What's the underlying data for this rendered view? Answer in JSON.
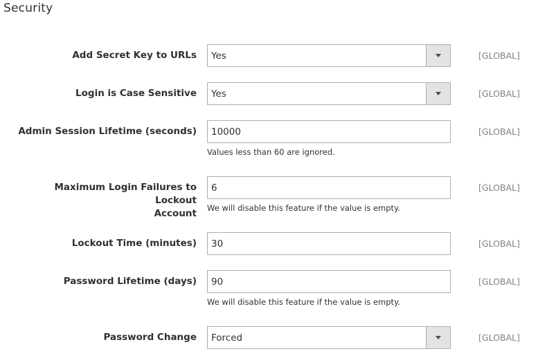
{
  "section": {
    "title": "Security"
  },
  "fields": [
    {
      "label": "Add Secret Key to URLs",
      "type": "select",
      "value": "Yes",
      "scope": "[GLOBAL]"
    },
    {
      "label": "Login is Case Sensitive",
      "type": "select",
      "value": "Yes",
      "scope": "[GLOBAL]"
    },
    {
      "label": "Admin Session Lifetime (seconds)",
      "type": "text",
      "value": "10000",
      "scope": "[GLOBAL]",
      "note": "Values less than 60 are ignored."
    },
    {
      "label_line1": "Maximum Login Failures to Lockout",
      "label_line2": "Account",
      "type": "text",
      "value": "6",
      "scope": "[GLOBAL]",
      "note": "We will disable this feature if the value is empty."
    },
    {
      "label": "Lockout Time (minutes)",
      "type": "text",
      "value": "30",
      "scope": "[GLOBAL]"
    },
    {
      "label": "Password Lifetime (days)",
      "type": "text",
      "value": "90",
      "scope": "[GLOBAL]",
      "note": "We will disable this feature if the value is empty."
    },
    {
      "label": "Password Change",
      "type": "select",
      "value": "Forced",
      "scope": "[GLOBAL]"
    }
  ]
}
